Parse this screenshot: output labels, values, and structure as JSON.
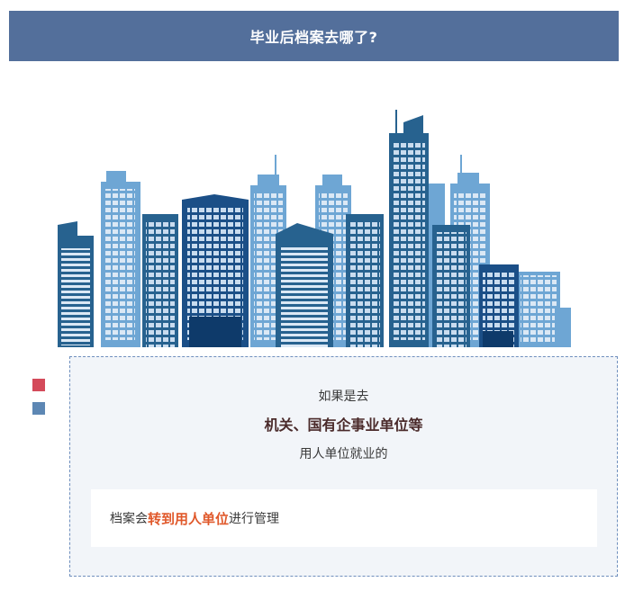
{
  "header": {
    "title": "毕业后档案去哪了?"
  },
  "illustration": {
    "name": "city-skyline"
  },
  "colors": {
    "header": "#536f9b",
    "accent_red": "#d44a5a",
    "accent_blue": "#5d87b4",
    "highlight": "#e0582a"
  },
  "panel": {
    "line1": "如果是去",
    "line2": "机关、国有企事业单位等",
    "line3": "用人单位就业的",
    "note": {
      "before": "档案会",
      "highlight": "转到用人单位",
      "after": "进行管理"
    }
  }
}
